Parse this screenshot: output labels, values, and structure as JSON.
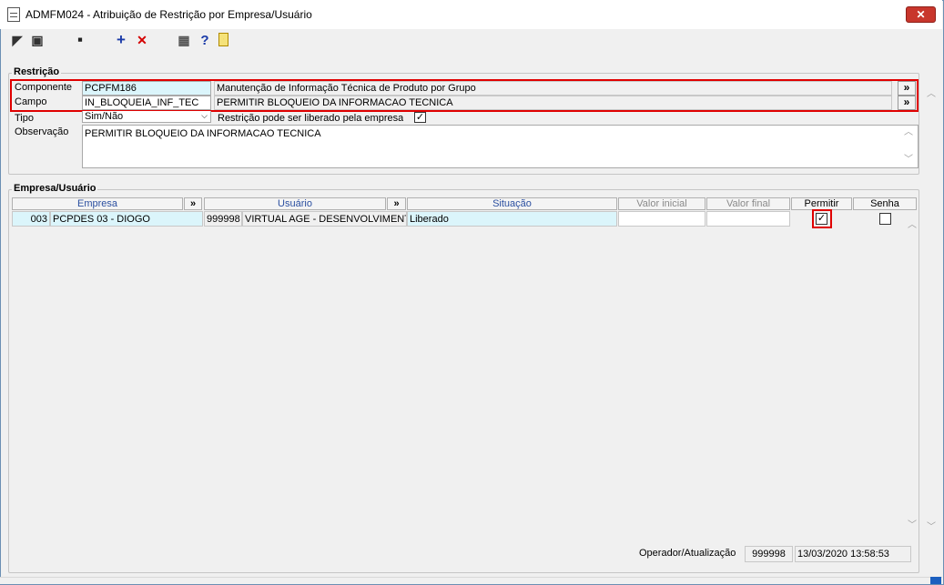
{
  "window": {
    "title": "ADMFM024 - Atribuição de Restrição por Empresa/Usuário",
    "close_label": "✕"
  },
  "toolbar": {
    "items": [
      {
        "name": "back-icon",
        "glyph": "◤"
      },
      {
        "name": "copy-icon",
        "glyph": "▣"
      },
      {
        "name": "save-icon",
        "glyph": "▪"
      },
      {
        "name": "add-icon",
        "glyph": "+"
      },
      {
        "name": "delete-icon",
        "glyph": "✕"
      },
      {
        "name": "grid-icon",
        "glyph": "▦"
      },
      {
        "name": "help-icon",
        "glyph": "?"
      },
      {
        "name": "exit-icon",
        "glyph": "▯"
      }
    ]
  },
  "restricao": {
    "legend": "Restrição",
    "componente_label": "Componente",
    "componente_code": "PCPFM186",
    "componente_desc": "Manutenção de Informação Técnica de Produto por Grupo",
    "campo_label": "Campo",
    "campo_code": "IN_BLOQUEIA_INF_TEC",
    "campo_desc": "PERMITIR BLOQUEIO DA INFORMACAO TECNICA",
    "tipo_label": "Tipo",
    "tipo_value": "Sim/Não",
    "liberado_label": "Restrição pode ser liberado pela empresa",
    "liberado_checked": "✓",
    "observacao_label": "Observação",
    "observacao_value": "PERMITIR BLOQUEIO DA INFORMACAO TECNICA",
    "more_label": "»"
  },
  "empresa_usuario": {
    "legend": "Empresa/Usuário",
    "columns": {
      "empresa": "Empresa",
      "usuario": "Usuário",
      "situacao": "Situação",
      "valor_inicial": "Valor inicial",
      "valor_final": "Valor final",
      "permitir": "Permitir",
      "senha": "Senha",
      "more": "»"
    },
    "rows": [
      {
        "empresa_code": "003",
        "empresa_name": "PCPDES 03 - DIOGO",
        "usuario_code": "999998",
        "usuario_name": "VIRTUAL AGE - DESENVOLVIMENTO",
        "situacao": "Liberado",
        "valor_inicial": "",
        "valor_final": "",
        "permitir": "✓",
        "senha": ""
      }
    ]
  },
  "footer": {
    "label": "Operador/Atualização",
    "operador": "999998",
    "atualizacao": "13/03/2020 13:58:53"
  },
  "colors": {
    "highlight": "#e00000",
    "selected_cell": "#dbf5fb",
    "header_blue": "#2b4fa0"
  }
}
